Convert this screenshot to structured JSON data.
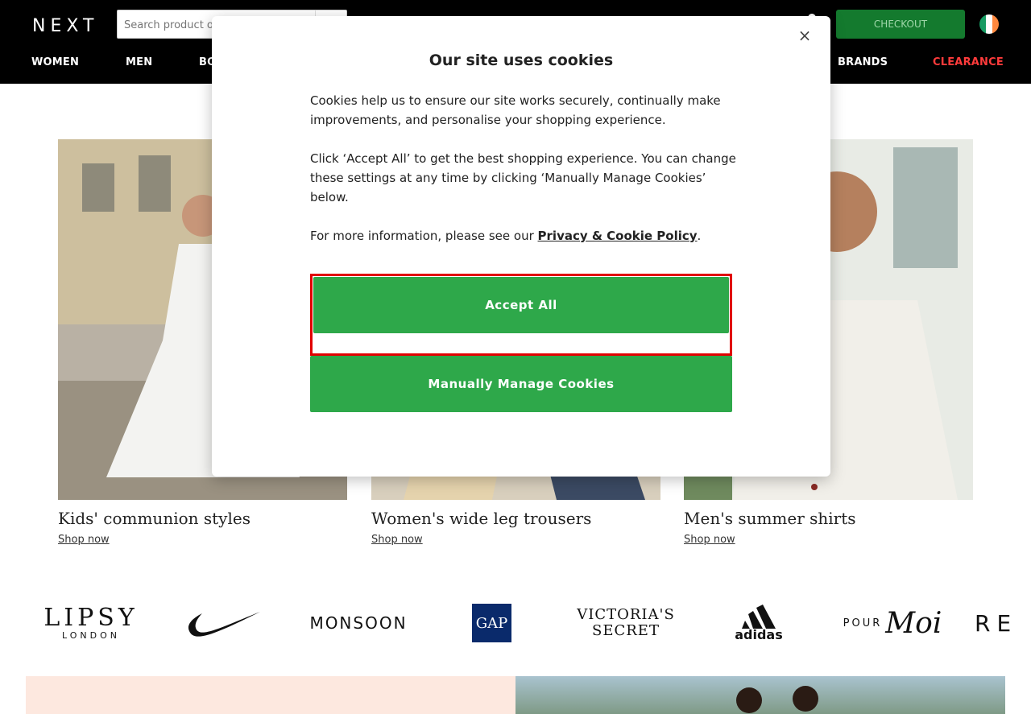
{
  "header": {
    "logo": "NEXT",
    "search_placeholder": "Search product or brand",
    "checkout_label": "CHECKOUT",
    "flag": "ireland-flag-icon"
  },
  "nav": {
    "items": [
      "WOMEN",
      "MEN",
      "BOYS",
      "BRANDS",
      "CLEARANCE"
    ]
  },
  "cards": [
    {
      "title": "Kids' communion styles",
      "link": "Shop now"
    },
    {
      "title": "Women's wide leg trousers",
      "link": "Shop now"
    },
    {
      "title": "Men's summer shirts",
      "link": "Shop now"
    }
  ],
  "brands": [
    "LIPSY",
    "LONDON",
    "MONSOON",
    "GAP",
    "VICTORIA'S",
    "SECRET",
    "adidas",
    "POUR",
    "Moi",
    "RE"
  ],
  "modal": {
    "title": "Our site uses cookies",
    "p1": "Cookies help us to ensure our site works securely, continually make improvements, and personalise your shopping experience.",
    "p2": "Click ‘Accept All’ to get the best shopping experience. You can change these settings at any time by clicking ‘Manually Manage Cookies’ below.",
    "p3_prefix": "For more information, please see our ",
    "p3_link": "Privacy & Cookie Policy",
    "p3_suffix": ".",
    "accept_label": "Accept All",
    "manage_label": "Manually Manage Cookies",
    "close": "×"
  },
  "colors": {
    "header_bg": "#000000",
    "checkout_bg": "#147a2e",
    "button_green": "#2ea84a",
    "clearance_red": "#ff3b3b",
    "highlight_red": "#e10000"
  }
}
